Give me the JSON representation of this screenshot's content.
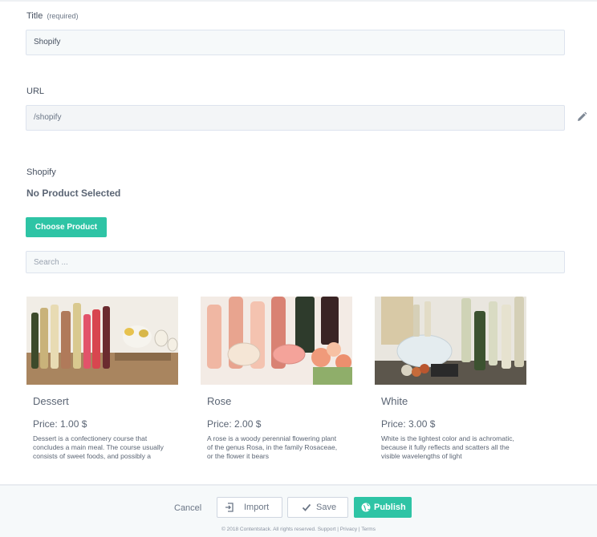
{
  "form": {
    "title_label": "Title",
    "title_required": "(required)",
    "title_value": "Shopify",
    "url_label": "URL",
    "url_value": "/shopify",
    "shopify_label": "Shopify",
    "no_product": "No Product Selected",
    "choose_button": "Choose Product",
    "search_placeholder": "Search ..."
  },
  "products": [
    {
      "name": "Dessert",
      "price": "Price: 1.00 $",
      "description": "Dessert is a confectionery course that concludes a main meal. The course usually consists of sweet foods, and possibly a beverage such as dessert"
    },
    {
      "name": "Rose",
      "price": "Price: 2.00 $",
      "description": "A rose is a woody perennial flowering plant of the genus Rosa, in the family Rosaceae, or the flower it bears"
    },
    {
      "name": "White",
      "price": "Price: 3.00 $",
      "description": "White is the lightest color and is achromatic, because it fully reflects and scatters all the visible wavelengths of light"
    }
  ],
  "footer": {
    "cancel": "Cancel",
    "import": "Import",
    "save": "Save",
    "publish": "Publish",
    "copyright": "© 2018 Contentstack. All rights reserved. Support | Privacy | Terms"
  },
  "colors": {
    "accent": "#2ec4a5",
    "input_bg": "#f6f9fa",
    "border": "#dde3ee"
  },
  "icons": [
    "pencil-icon",
    "import-icon",
    "check-icon",
    "globe-icon"
  ]
}
